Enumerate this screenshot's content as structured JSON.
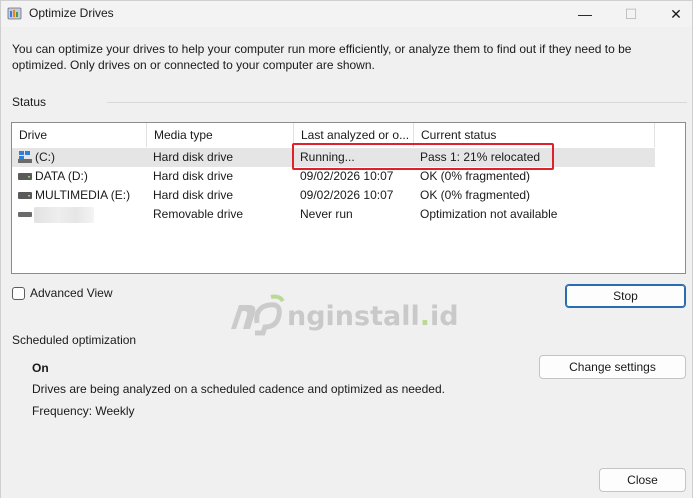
{
  "window": {
    "title": "Optimize Drives",
    "controls": {
      "minimize": "—",
      "maximize": "☐",
      "close": "✕"
    }
  },
  "intro_text": "You can optimize your drives to help your computer run more efficiently, or analyze them to find out if they need to be optimized. Only drives on or connected to your computer are shown.",
  "status": {
    "label": "Status",
    "columns": [
      "Drive",
      "Media type",
      "Last analyzed or o...",
      "Current status"
    ],
    "rows": [
      {
        "icon": "windows-drive-icon",
        "drive": "(C:)",
        "media": "Hard disk drive",
        "last": "Running...",
        "status": "Pass 1: 21% relocated"
      },
      {
        "icon": "hard-drive-icon",
        "drive": "DATA (D:)",
        "media": "Hard disk drive",
        "last": "09/02/2026 10:07",
        "status": "OK (0% fragmented)"
      },
      {
        "icon": "hard-drive-icon",
        "drive": "MULTIMEDIA (E:)",
        "media": "Hard disk drive",
        "last": "09/02/2026 10:07",
        "status": "OK (0% fragmented)"
      },
      {
        "icon": "removable-drive-icon",
        "drive": "",
        "media": "Removable drive",
        "last": "Never run",
        "status": "Optimization not available"
      }
    ]
  },
  "advanced_view_label": "Advanced View",
  "stop_label": "Stop",
  "scheduled": {
    "label": "Scheduled optimization",
    "state": "On",
    "description": "Drives are being analyzed on a scheduled cadence and optimized as needed.",
    "frequency": "Frequency: Weekly",
    "change_label": "Change settings"
  },
  "close_label": "Close",
  "watermark": {
    "prefix": "nginstall",
    "dot": ".",
    "suffix": "id"
  },
  "colors": {
    "highlight": "#e0202a",
    "accent": "#2b6cb0",
    "watermark_green": "#7bbf2a"
  }
}
